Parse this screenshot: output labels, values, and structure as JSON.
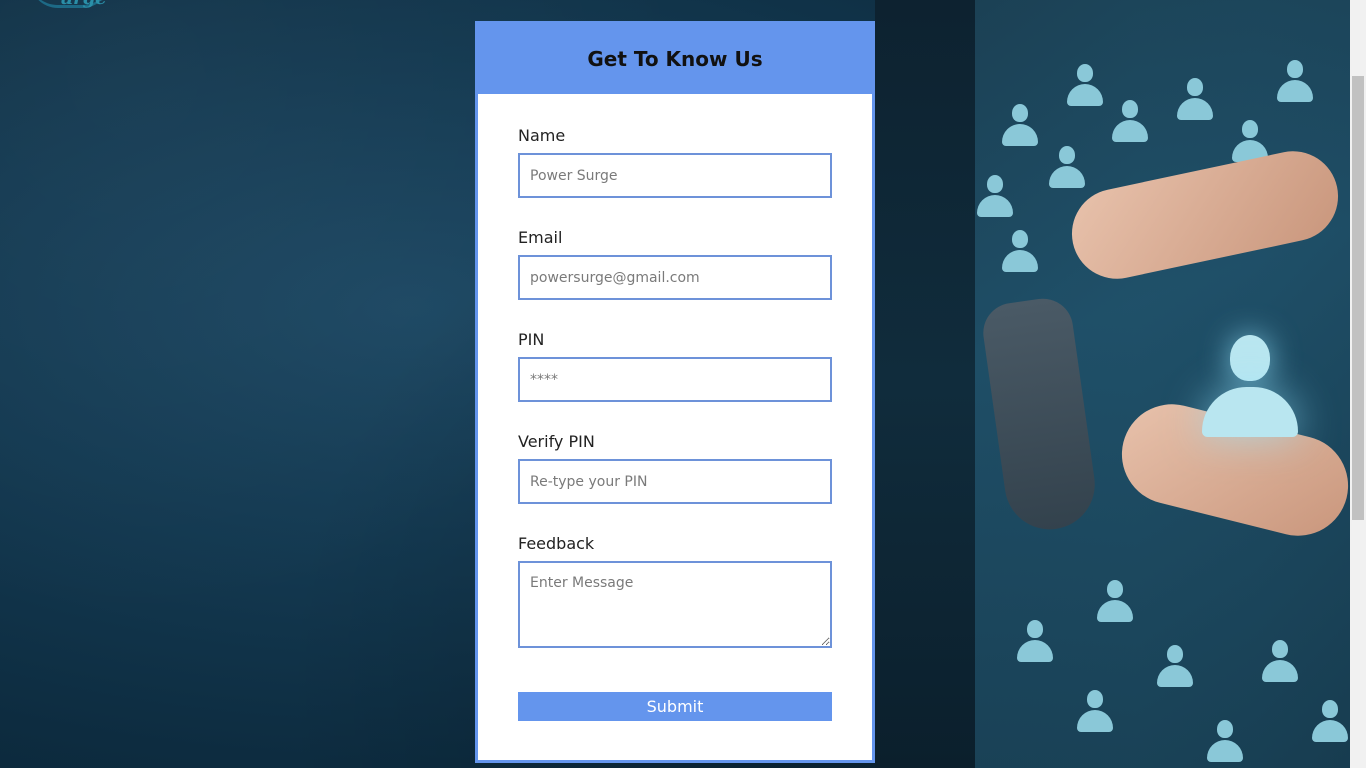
{
  "form": {
    "title": "Get To Know Us",
    "fields": [
      {
        "label": "Name",
        "placeholder": "Power Surge",
        "type": "text"
      },
      {
        "label": "Email",
        "placeholder": "powersurge@gmail.com",
        "type": "email"
      },
      {
        "label": "PIN",
        "placeholder": "****",
        "type": "password"
      },
      {
        "label": "Verify PIN",
        "placeholder": "Re-type your PIN",
        "type": "password"
      },
      {
        "label": "Feedback",
        "placeholder": "Enter Message",
        "type": "textarea"
      }
    ],
    "submit_label": "Submit"
  },
  "colors": {
    "accent": "#6495ed",
    "background": "#143a52"
  }
}
